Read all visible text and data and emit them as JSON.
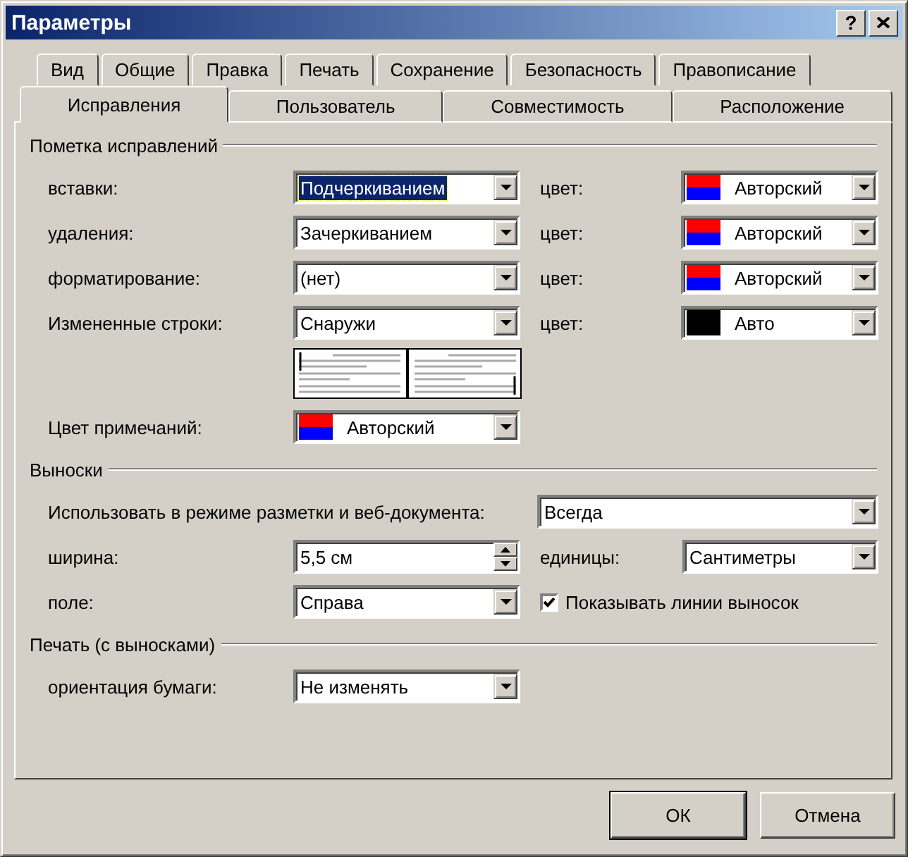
{
  "window": {
    "title": "Параметры",
    "help_button": "?"
  },
  "tabs_upper": [
    {
      "label": "Вид",
      "selected": false
    },
    {
      "label": "Общие",
      "selected": false
    },
    {
      "label": "Правка",
      "selected": false
    },
    {
      "label": "Печать",
      "selected": false
    },
    {
      "label": "Сохранение",
      "selected": false
    },
    {
      "label": "Безопасность",
      "selected": false
    },
    {
      "label": "Правописание",
      "selected": false
    }
  ],
  "tabs_lower": [
    {
      "label": "Исправления",
      "selected": true
    },
    {
      "label": "Пользователь",
      "selected": false
    },
    {
      "label": "Совместимость",
      "selected": false
    },
    {
      "label": "Расположение",
      "selected": false
    }
  ],
  "track_changes": {
    "title": "Пометка исправлений",
    "rows": [
      {
        "label": "вставки:",
        "value": "Подчеркиванием",
        "focused": true,
        "color_label": "цвет:",
        "color_value": "Авторский",
        "swatch": [
          {
            "color": "#ff0000"
          },
          {
            "color": "#0000ff"
          }
        ]
      },
      {
        "label": "удаления:",
        "value": "Зачеркиванием",
        "focused": false,
        "color_label": "цвет:",
        "color_value": "Авторский",
        "swatch": [
          {
            "color": "#ff0000"
          },
          {
            "color": "#0000ff"
          }
        ]
      },
      {
        "label": "форматирование:",
        "value": "(нет)",
        "focused": false,
        "color_label": "цвет:",
        "color_value": "Авторский",
        "swatch": [
          {
            "color": "#ff0000"
          },
          {
            "color": "#0000ff"
          }
        ]
      },
      {
        "label": "Измененные строки:",
        "value": "Снаружи",
        "focused": false,
        "color_label": "цвет:",
        "color_value": "Авто",
        "swatch": [
          {
            "color": "#000000"
          }
        ]
      }
    ],
    "comment_color": {
      "label": "Цвет примечаний:",
      "value": "Авторский",
      "swatch": [
        {
          "color": "#ff0000"
        },
        {
          "color": "#0000ff"
        }
      ]
    }
  },
  "balloons": {
    "title": "Выноски",
    "use_label": "Использовать в режиме разметки и веб-документа:",
    "use_value": "Всегда",
    "width_label": "ширина:",
    "width_value": "5,5 см",
    "units_label": "единицы:",
    "units_value": "Сантиметры",
    "margin_label": "поле:",
    "margin_value": "Справа",
    "show_lines": {
      "label": "Показывать линии выносок",
      "checked": true
    }
  },
  "printing": {
    "title": "Печать (с выносками)",
    "orientation_label": "ориентация бумаги:",
    "orientation_value": "Не изменять"
  },
  "buttons": [
    {
      "label": "ОК",
      "default": true
    },
    {
      "label": "Отмена",
      "default": false
    }
  ]
}
